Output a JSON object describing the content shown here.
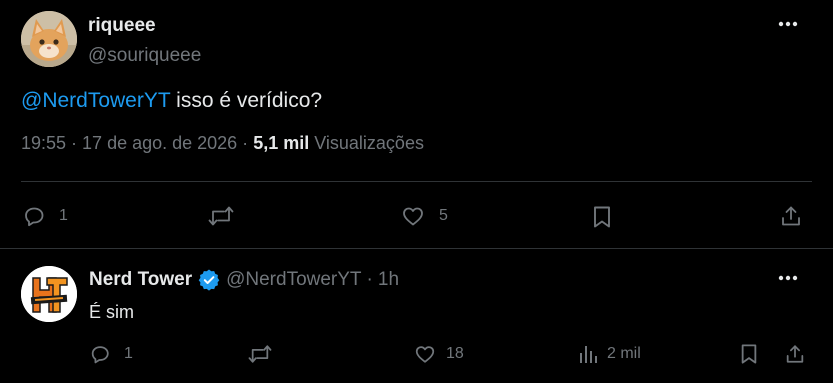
{
  "main_tweet": {
    "author": {
      "name": "riqueee",
      "handle": "@souriqueee",
      "avatar_icon": "cat-photo-avatar"
    },
    "text": {
      "mention": "@NerdTowerYT",
      "body": " isso é verídico?"
    },
    "meta": {
      "timestamp": "19:55 · 17 de ago. de 2026 · ",
      "views_count": "5,1 mil",
      "views_label": " Visualizações"
    },
    "actions": {
      "replies": "1",
      "reposts": "",
      "likes": "5"
    }
  },
  "reply": {
    "author": {
      "name": "Nerd Tower",
      "handle": "@NerdTowerYT",
      "separator": "·",
      "time": "1h",
      "avatar_icon": "nerd-tower-logo-avatar",
      "verified_icon": "verified-badge-icon"
    },
    "text": "É sim",
    "actions": {
      "replies": "1",
      "reposts": "",
      "likes": "18",
      "views": "2 mil"
    }
  },
  "colors": {
    "background": "#000000",
    "text_primary": "#e7e9ea",
    "text_secondary": "#71767b",
    "accent": "#1d9bf0",
    "divider": "#2f3336"
  }
}
